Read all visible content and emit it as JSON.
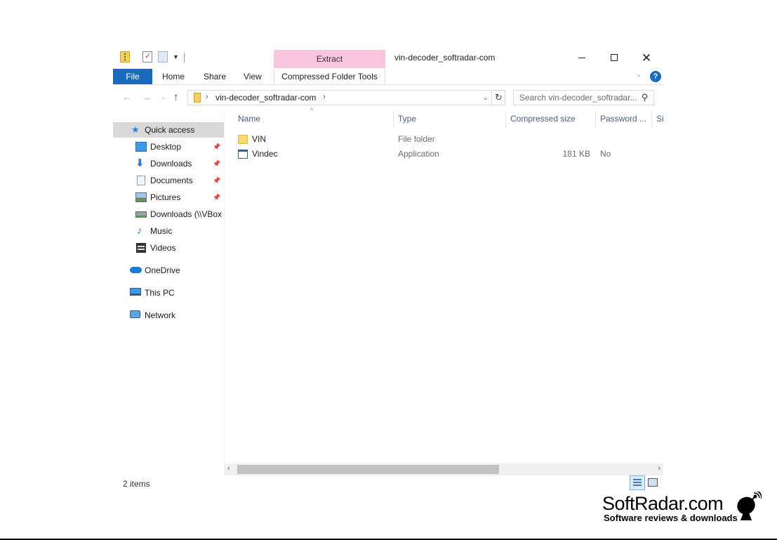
{
  "window": {
    "title": "vin-decoder_softradar-com",
    "context_tab": "Extract"
  },
  "ribbon": {
    "tabs": [
      {
        "label": "File"
      },
      {
        "label": "Home"
      },
      {
        "label": "Share"
      },
      {
        "label": "View"
      },
      {
        "label": "Compressed Folder Tools"
      }
    ]
  },
  "address": {
    "path": "vin-decoder_softradar-com",
    "search_placeholder": "Search vin-decoder_softradar..."
  },
  "nav_pane": {
    "items": [
      {
        "label": "Quick access",
        "icon": "star-icon"
      },
      {
        "label": "Desktop",
        "icon": "desktop-icon",
        "pinned": true
      },
      {
        "label": "Downloads",
        "icon": "download-arrow-icon",
        "pinned": true
      },
      {
        "label": "Documents",
        "icon": "document-icon",
        "pinned": true
      },
      {
        "label": "Pictures",
        "icon": "pictures-icon",
        "pinned": true
      },
      {
        "label": "Downloads (\\\\VBox",
        "icon": "network-drive-icon"
      },
      {
        "label": "Music",
        "icon": "music-note-icon"
      },
      {
        "label": "Videos",
        "icon": "film-icon"
      },
      {
        "label": "OneDrive",
        "icon": "cloud-icon"
      },
      {
        "label": "This PC",
        "icon": "monitor-icon"
      },
      {
        "label": "Network",
        "icon": "network-icon"
      }
    ]
  },
  "file_list": {
    "columns": [
      "Name",
      "Type",
      "Compressed size",
      "Password ...",
      "Si"
    ],
    "rows": [
      {
        "name": "VIN",
        "type": "File folder",
        "size": "",
        "password": "",
        "icon": "folder-icon"
      },
      {
        "name": "Vindec",
        "type": "Application",
        "size": "181 KB",
        "password": "No",
        "icon": "application-icon"
      }
    ]
  },
  "status": {
    "item_count": "2 items"
  },
  "watermark": {
    "title": "SoftRadar.com",
    "subtitle": "Software reviews & downloads"
  },
  "colors": {
    "file_tab": "#1a6bbf",
    "context_tab": "#f9c4dd",
    "selected_nav": "#d9d9d9"
  }
}
